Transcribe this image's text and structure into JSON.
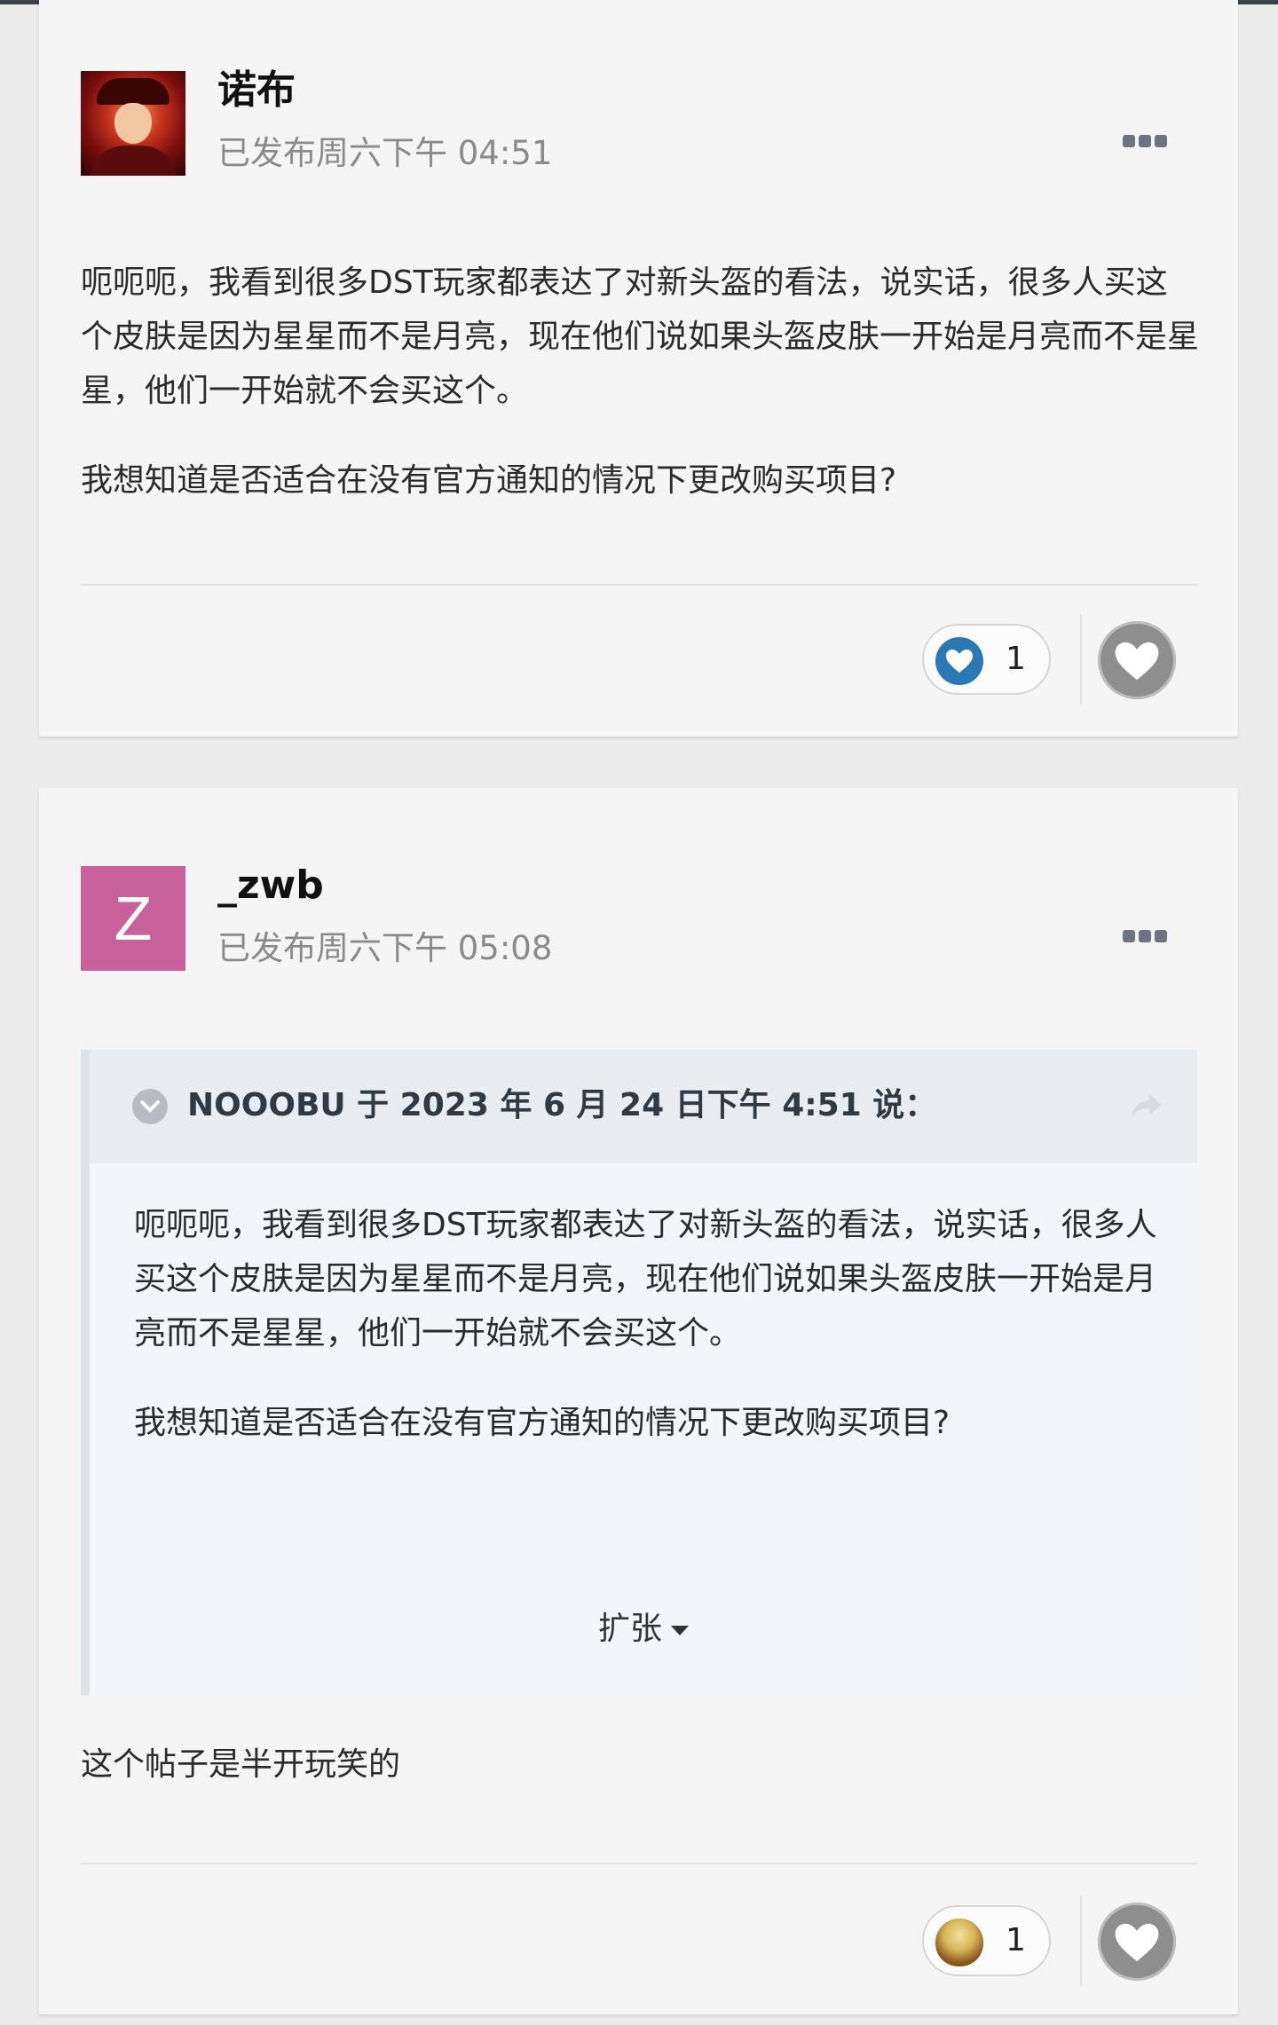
{
  "posts": [
    {
      "author": "诺布",
      "posted": "已发布周六下午 04:51",
      "paragraphs": [
        "呃呃呃，我看到很多DST玩家都表达了对新头盔的看法，说实话，很多人买这个皮肤是因为星星而不是月亮，现在他们说如果头盔皮肤一开始是月亮而不是星星，他们一开始就不会买这个。",
        "我想知道是否适合在没有官方通知的情况下更改购买项目?"
      ],
      "reaction_count": "1",
      "reaction_icon": "heart-icon",
      "reaction_color": "#2a78b4"
    },
    {
      "author": "_zwb",
      "avatar_letter": "Z",
      "avatar_color": "#c8609b",
      "posted": "已发布周六下午 05:08",
      "quote": {
        "title": "NOOOBU 于 2023 年 6 月 24 日下午 4:51 说：",
        "paragraphs": [
          "呃呃呃，我看到很多DST玩家都表达了对新头盔的看法，说实话，很多人买这个皮肤是因为星星而不是月亮，现在他们说如果头盔皮肤一开始是月亮而不是星星，他们一开始就不会买这个。",
          "我想知道是否适合在没有官方通知的情况下更改购买项目?"
        ],
        "expand_label": "扩张"
      },
      "reply": "这个帖子是半开玩笑的",
      "reaction_count": "1",
      "reaction_icon": "potato-icon"
    }
  ]
}
